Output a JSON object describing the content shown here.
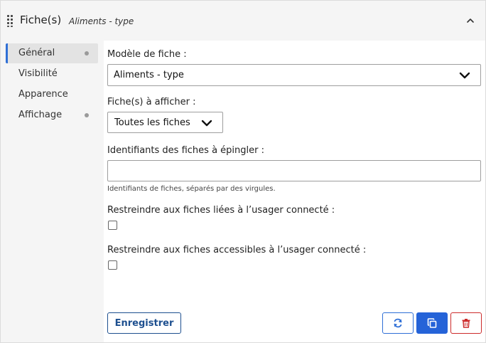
{
  "header": {
    "title": "Fiche(s)",
    "subtitle": "Aliments - type"
  },
  "sidebar": {
    "items": [
      {
        "label": "Général",
        "active": true,
        "dot": true
      },
      {
        "label": "Visibilité",
        "active": false,
        "dot": false
      },
      {
        "label": "Apparence",
        "active": false,
        "dot": false
      },
      {
        "label": "Affichage",
        "active": false,
        "dot": true
      }
    ]
  },
  "form": {
    "model_label": "Modèle de fiche :",
    "model_value": "Aliments - type",
    "display_label": "Fiche(s) à afficher :",
    "display_value": "Toutes les fiches",
    "ids_label": "Identifiants des fiches à épingler :",
    "ids_value": "",
    "ids_help": "Identifiants de fiches, séparés par des virgules.",
    "restrict_linked_label": "Restreindre aux fiches liées à l’usager connecté :",
    "restrict_linked_checked": false,
    "restrict_accessible_label": "Restreindre aux fiches accessibles à l’usager connecté :",
    "restrict_accessible_checked": false
  },
  "actions": {
    "save_label": "Enregistrer",
    "refresh_icon": "refresh-icon",
    "copy_icon": "copy-icon",
    "delete_icon": "trash-icon"
  },
  "colors": {
    "accent": "#2563d8",
    "save_border": "#1d4f8f",
    "danger": "#cc2b2b",
    "panel_bg": "#f5f5f5"
  }
}
